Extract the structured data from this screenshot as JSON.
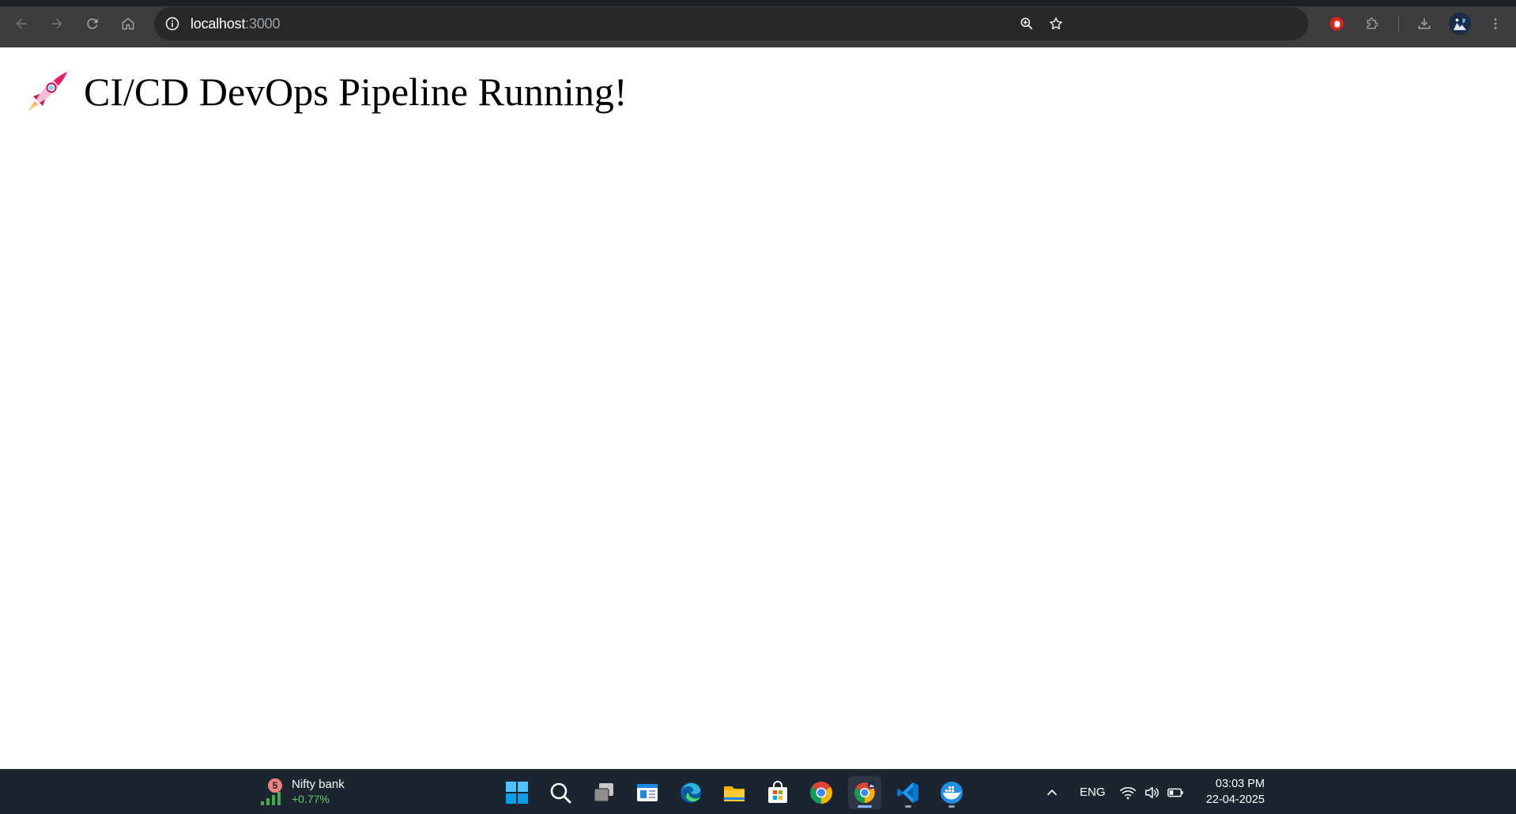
{
  "browser": {
    "url_host": "localhost",
    "url_port": ":3000",
    "icons": {
      "back": "arrow-left-icon",
      "forward": "arrow-right-icon",
      "reload": "reload-icon",
      "home": "home-icon",
      "site_info": "info-icon",
      "zoom": "zoom-in-icon",
      "bookmark": "star-icon",
      "extension_red": "adblock-hand-icon",
      "extensions": "puzzle-icon",
      "downloads": "download-icon",
      "profile": "avatar-icon",
      "menu": "kebab-menu-icon"
    }
  },
  "page": {
    "heading_emoji": "rocket",
    "heading": "CI/CD DevOps Pipeline Running!"
  },
  "taskbar": {
    "widget": {
      "badge": "5",
      "title": "Nifty bank",
      "value": "+0.77%",
      "value_color": "#5fcf6b"
    },
    "apps": [
      "windows-start",
      "search",
      "task-view",
      "widgets-news",
      "microsoft-edge",
      "file-explorer",
      "microsoft-store",
      "google-chrome",
      "google-chrome-active",
      "visual-studio-code",
      "docker-desktop"
    ],
    "tray": {
      "language": "ENG"
    },
    "clock": {
      "time": "03:03 PM",
      "date": "22-04-2025"
    }
  }
}
